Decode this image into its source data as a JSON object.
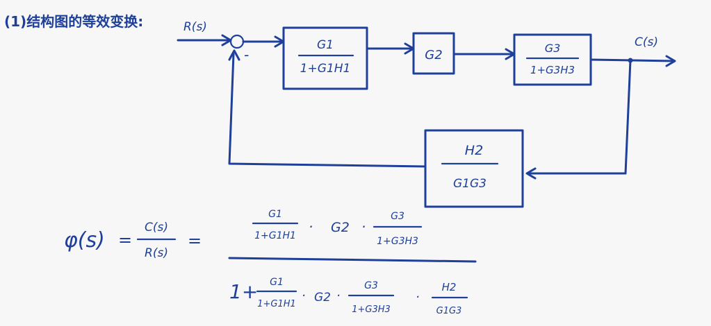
{
  "heading": "(1)结构图的等效变换:",
  "signals": {
    "input": "R(s)",
    "output": "C(s)",
    "sum_sign": "-"
  },
  "blocks": {
    "block1": {
      "num": "G1",
      "den": "1+G1H1"
    },
    "block2": {
      "label": "G2"
    },
    "block3": {
      "num": "G3",
      "den": "1+G3H3"
    },
    "feedback": {
      "num": "H2",
      "den": "G1G3"
    }
  },
  "formula": {
    "lhs": "φ(s)",
    "eq1": "=",
    "ratio_num": "C(s)",
    "ratio_den": "R(s)",
    "eq2": "=",
    "num": {
      "t1_num": "G1",
      "t1_den": "1+G1H1",
      "dot1": "·",
      "t2": "G2",
      "dot2": "·",
      "t3_num": "G3",
      "t3_den": "1+G3H3"
    },
    "den": {
      "one_plus": "1+",
      "t1_num": "G1",
      "t1_den": "1+G1H1",
      "dot1": "·",
      "t2": "G2",
      "dot2": "·",
      "t3_num": "G3",
      "t3_den": "1+G3H3",
      "dot3": "·",
      "t4_num": "H2",
      "t4_den": "G1G3"
    }
  }
}
